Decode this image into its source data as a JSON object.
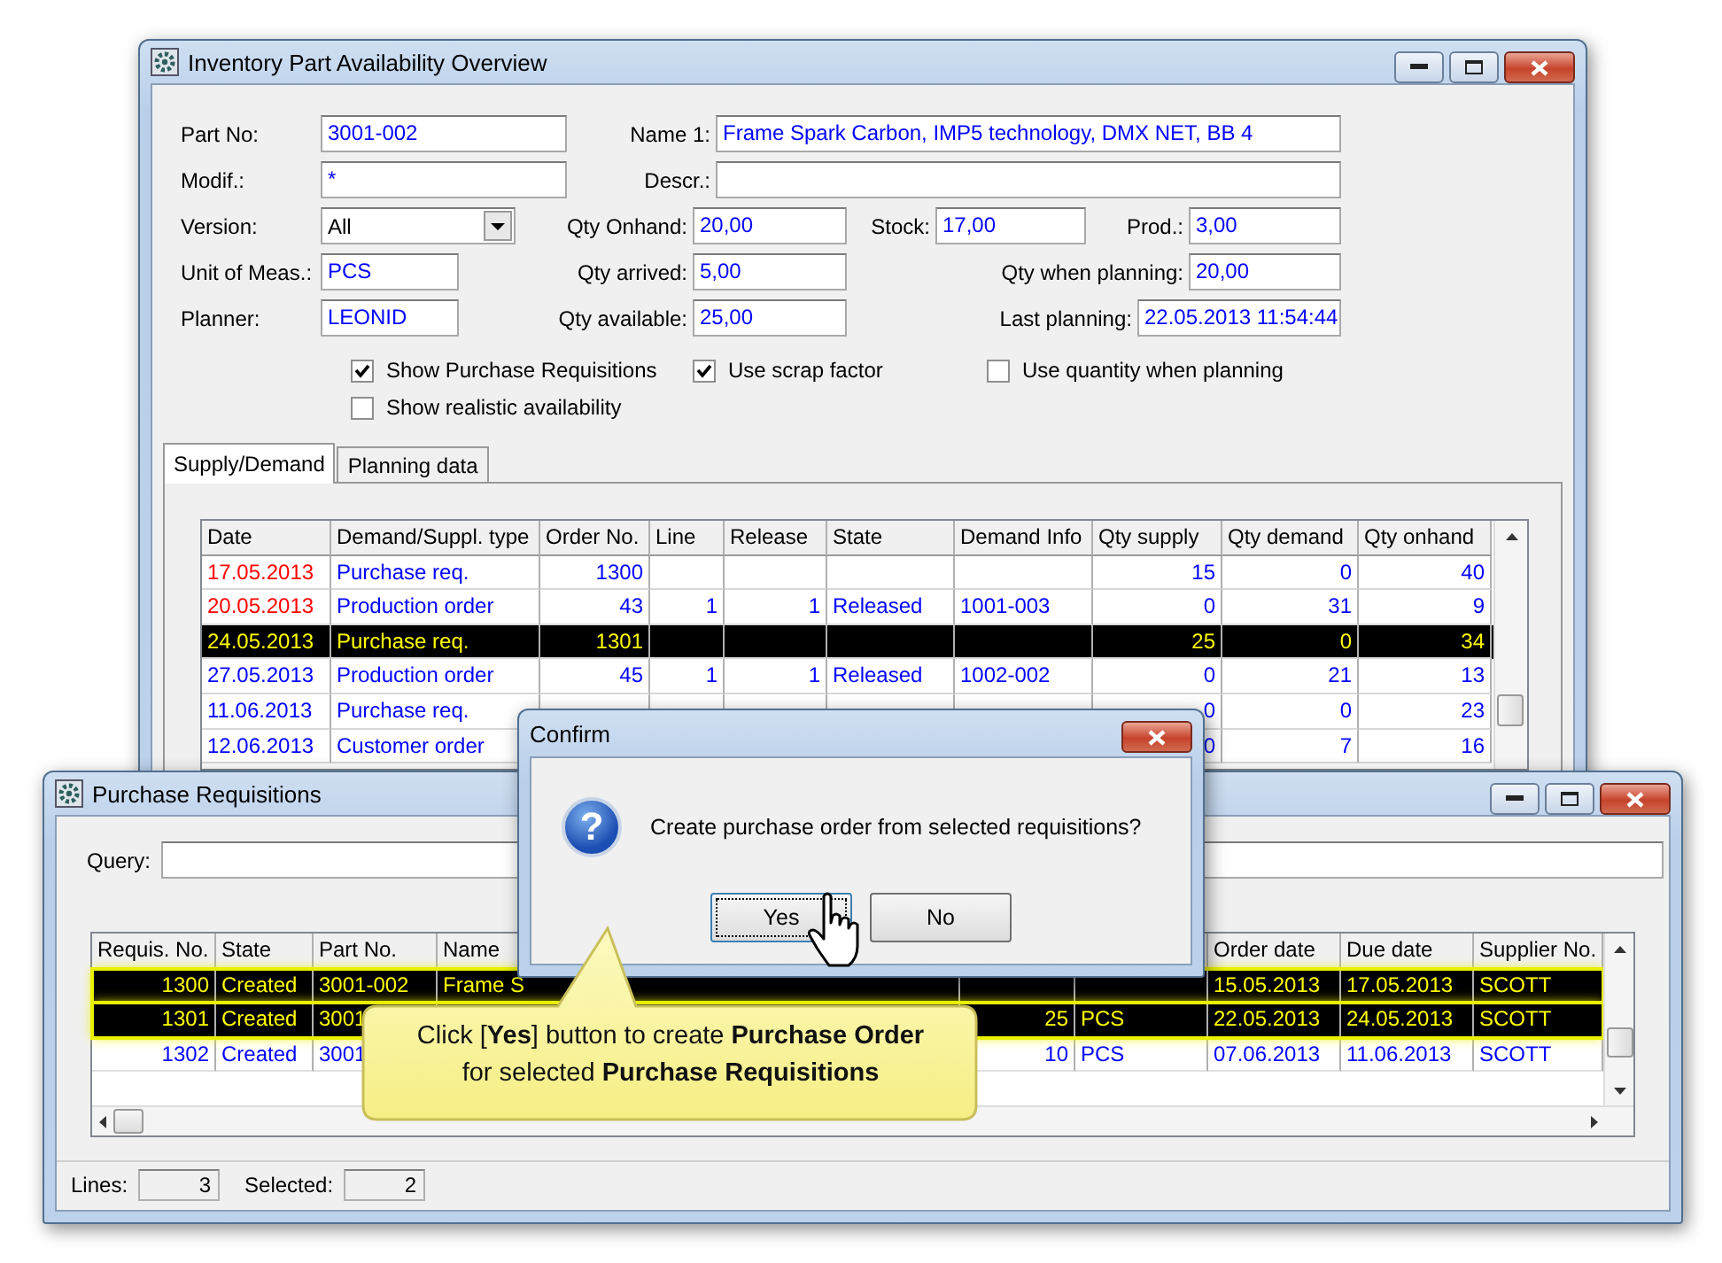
{
  "main_window": {
    "title": "Inventory Part Availability Overview",
    "form_rows": [
      [
        {
          "label": "Part No:",
          "value": "3001-002",
          "kind": "text"
        },
        {
          "label": "Name 1:",
          "value": "Frame Spark Carbon, IMP5 technology, DMX NET, BB 4",
          "kind": "text"
        }
      ],
      [
        {
          "label": "Modif.:",
          "value": "*",
          "kind": "text"
        },
        {
          "label": "Descr.:",
          "kind": "text"
        }
      ],
      [
        {
          "label": "Version:",
          "value": "All",
          "kind": "dropdown"
        },
        {
          "label": "Qty Onhand:",
          "value": "20,00",
          "kind": "text"
        },
        {
          "label": "Stock:",
          "value": "17,00",
          "kind": "text"
        },
        {
          "label": "Prod.:",
          "value": "3,00",
          "kind": "text"
        }
      ],
      [
        {
          "label": "Unit of Meas.:",
          "value": "PCS",
          "kind": "text"
        },
        {
          "label": "Qty arrived:",
          "value": "5,00",
          "kind": "text"
        },
        {
          "label": "Qty when planning:",
          "value": "20,00",
          "kind": "text"
        }
      ],
      [
        {
          "label": "Planner:",
          "value": "LEONID",
          "kind": "text"
        },
        {
          "label": "Qty available:",
          "value": "25,00",
          "kind": "text"
        },
        {
          "label": "Last planning:",
          "value": "22.05.2013 11:54:44",
          "kind": "text"
        }
      ]
    ],
    "checkbox_rows": [
      [
        {
          "label": "Show Purchase Requisitions",
          "checked": true
        },
        {
          "label": "Use scrap factor",
          "checked": true
        },
        {
          "label": "Use quantity when planning",
          "checked": false
        }
      ],
      [
        {
          "label": "Show realistic availability",
          "checked": false
        }
      ]
    ],
    "tabs": [
      {
        "label": "Supply/Demand",
        "selected": true
      },
      {
        "label": "Planning data",
        "selected": false
      }
    ],
    "table": {
      "columns": [
        "Date",
        "Demand/Suppl. type",
        "Order No.",
        "Line",
        "Release",
        "State",
        "Demand Info",
        "Qty supply",
        "Qty demand",
        "Qty onhand"
      ],
      "rows": [
        {
          "cells": [
            "17.05.2013",
            "Purchase req.",
            "1300",
            null,
            null,
            null,
            null,
            "15",
            "0",
            "40"
          ],
          "overdue": true,
          "selected": false
        },
        {
          "cells": [
            "20.05.2013",
            "Production order",
            "43",
            "1",
            "1",
            "Released",
            "1001-003",
            "0",
            "31",
            "9"
          ],
          "overdue": true,
          "selected": false
        },
        {
          "cells": [
            "24.05.2013",
            "Purchase req.",
            "1301",
            null,
            null,
            null,
            null,
            "25",
            "0",
            "34"
          ],
          "overdue": false,
          "selected": true
        },
        {
          "cells": [
            "27.05.2013",
            "Production order",
            "45",
            "1",
            "1",
            "Released",
            "1002-002",
            "0",
            "21",
            "13"
          ],
          "overdue": false,
          "selected": false
        },
        {
          "cells": [
            "11.06.2013",
            "Purchase req.",
            null,
            null,
            null,
            null,
            null,
            "0",
            "0",
            "23"
          ],
          "overdue": false,
          "selected": false
        },
        {
          "cells": [
            "12.06.2013",
            "Customer order",
            null,
            null,
            null,
            null,
            null,
            "0",
            "7",
            "16"
          ],
          "overdue": false,
          "selected": false
        }
      ]
    }
  },
  "requisitions_window": {
    "title": "Purchase Requisitions",
    "query_label": "Query:",
    "table": {
      "columns": [
        "Requis. No.",
        "State",
        "Part No.",
        "Name",
        null,
        null,
        "Order date",
        "Due date",
        "Supplier No."
      ],
      "rows": [
        {
          "cells": [
            "1300",
            "Created",
            "3001-002",
            "Frame S",
            null,
            null,
            "15.05.2013",
            "17.05.2013",
            "SCOTT"
          ],
          "selected": true
        },
        {
          "cells": [
            "1301",
            "Created",
            "3001",
            null,
            "25",
            "PCS",
            "22.05.2013",
            "24.05.2013",
            "SCOTT"
          ],
          "selected": true
        },
        {
          "cells": [
            "1302",
            "Created",
            "3001",
            null,
            "10",
            "PCS",
            "07.06.2013",
            "11.06.2013",
            "SCOTT"
          ],
          "selected": false
        }
      ]
    },
    "status_bar": [
      {
        "label": "Lines:",
        "value": "3"
      },
      {
        "label": "Selected:",
        "value": "2"
      }
    ]
  },
  "confirm": {
    "title": "Confirm",
    "icon": "?",
    "message": "Create purchase order from selected requisitions?",
    "buttons": [
      {
        "label": "Yes",
        "focused": true
      },
      {
        "label": "No",
        "focused": false
      }
    ]
  },
  "callout": {
    "text": "Click [**Yes**] button to create **Purchase Order** for selected **Purchase Requisitions**"
  }
}
